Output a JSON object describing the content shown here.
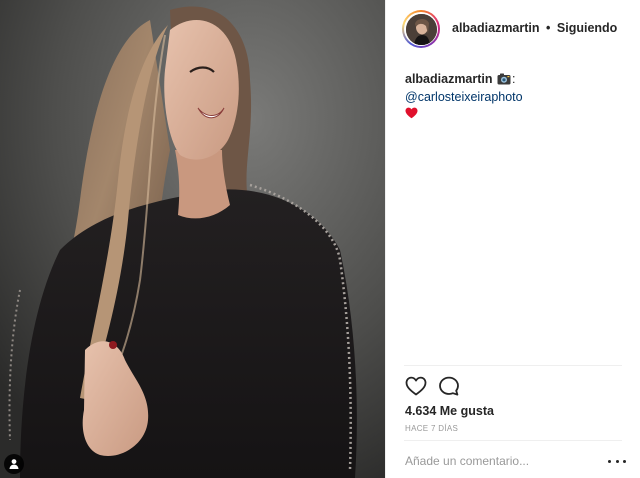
{
  "post": {
    "username": "albadiazmartin",
    "separator": "•",
    "follow_status": "Siguiendo",
    "caption": {
      "username": "albadiazmartin",
      "camera_icon": "camera-emoji",
      "colon": ":",
      "mention": "@carlosteixeiraphoto",
      "heart_icon": "red-heart-emoji"
    },
    "likes": "4.634 Me gusta",
    "timestamp": "HACE 7 DÍAS",
    "comment_placeholder": "Añade un comentario...",
    "accent": "#003569",
    "heart_color": "#e0102c"
  }
}
